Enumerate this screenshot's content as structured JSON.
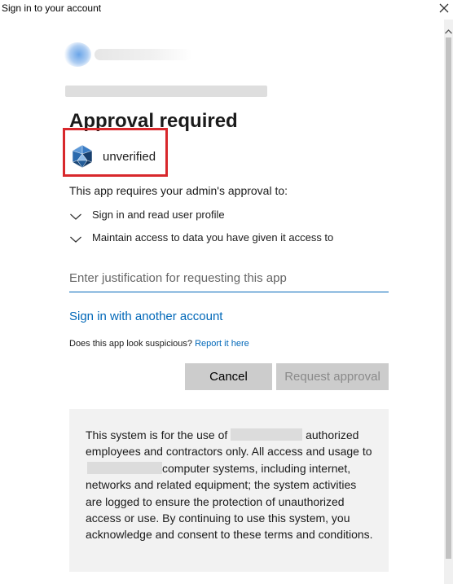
{
  "window": {
    "title": "Sign in to your account",
    "close_icon": "close-icon"
  },
  "accent_color": "#0067b8",
  "page": {
    "heading": "Approval required"
  },
  "app": {
    "name": "unverified",
    "icon": "app-polyhedron-icon"
  },
  "permissions": {
    "intro": "This app requires your admin's approval to:",
    "items": [
      {
        "label": "Sign in and read user profile"
      },
      {
        "label": "Maintain access to data you have given it access to"
      }
    ]
  },
  "justification": {
    "placeholder": "Enter justification for requesting this app",
    "value": ""
  },
  "links": {
    "another_account": "Sign in with another account",
    "suspicious_text": "Does this app look suspicious?",
    "report": "Report it here"
  },
  "buttons": {
    "cancel": "Cancel",
    "request": "Request approval"
  },
  "notice": {
    "part1": "This system is for the use of",
    "part2": "authorized employees and contractors only. All access and usage to",
    "part3": "computer systems, including internet, networks and related equipment; the system activities are logged to ensure the protection of unauthorized access or use. By continuing to use this system, you acknowledge and consent to these terms and conditions."
  }
}
